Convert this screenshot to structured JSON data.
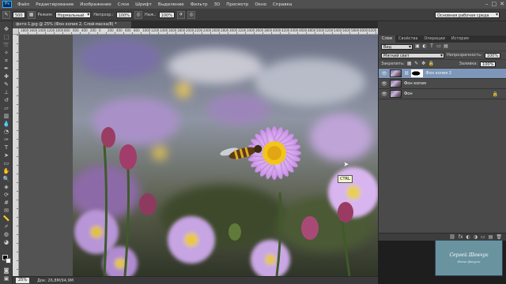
{
  "app": {
    "logo": "Ps"
  },
  "menu": [
    "Файл",
    "Редактирование",
    "Изображение",
    "Слои",
    "Шрифт",
    "Выделение",
    "Фильтр",
    "3D",
    "Просмотр",
    "Окно",
    "Справка"
  ],
  "window_controls": [
    "–",
    "□",
    "✕"
  ],
  "options": {
    "brush_size": "500",
    "mode_label": "Режим:",
    "mode_value": "Нормальный",
    "opacity_label": "Непрозр.:",
    "opacity_value": "100%",
    "flow_label": "Наж.:",
    "flow_value": "100%",
    "workspace": "Основная рабочая среда"
  },
  "document": {
    "tab_title": "фото-1.jpg @ 25% (Фон копия 2, Слой-маска/8) *",
    "zoom": "25%",
    "doc_size": "Док: 26,8M/94,9M"
  },
  "ruler": {
    "top_numbers": [
      "1800",
      "1600",
      "1400",
      "1200",
      "1000",
      "800",
      "600",
      "400",
      "200",
      "0",
      "200",
      "400",
      "600",
      "800",
      "1000",
      "1200",
      "1400",
      "1600",
      "1800",
      "2000",
      "2200",
      "2400",
      "2600",
      "2800",
      "3000",
      "3200",
      "3400",
      "3600",
      "3800",
      "4000",
      "4200",
      "4400",
      "4600",
      "4800",
      "5000",
      "5200",
      "5400",
      "5600",
      "5800",
      "6000",
      "6200"
    ]
  },
  "tooltip": {
    "text": "CTRL"
  },
  "panel": {
    "tabs": [
      "Слои",
      "Свойства",
      "Операции",
      "История"
    ],
    "kind_label": "Вид",
    "blend_mode": "Мягкий свет",
    "opacity_label": "Непрозрачность:",
    "opacity_value": "100%",
    "lock_label": "Закрепить:",
    "fill_label": "Заливка:",
    "fill_value": "100%",
    "layers": [
      {
        "name": "Фон копия 2",
        "selected": true
      },
      {
        "name": "Фон копия",
        "selected": false
      },
      {
        "name": "Фон",
        "selected": false
      }
    ],
    "footer_icons": [
      "⛓",
      "fx",
      "◐",
      "◑",
      "▭",
      "▤",
      "🗑"
    ]
  },
  "watermark": {
    "name": "Сергей Шевчук",
    "sub": "Фото фокусы"
  }
}
